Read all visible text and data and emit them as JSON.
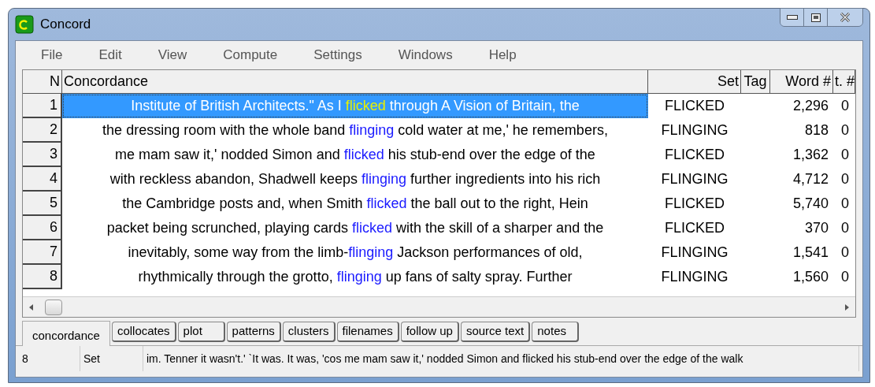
{
  "window": {
    "title": "Concord"
  },
  "menu": [
    "File",
    "Edit",
    "View",
    "Compute",
    "Settings",
    "Windows",
    "Help"
  ],
  "table": {
    "columns": [
      "N",
      "Concordance",
      "Set",
      "Tag",
      "Word #",
      "t. #"
    ],
    "rows": [
      {
        "n": "1",
        "left": "Institute of British Architects.\" As I ",
        "keyword": "flicked",
        "right": " through A Vision of Britain, the",
        "set": "FLICKED",
        "tag": "",
        "word": "2,296",
        "t": "0",
        "selected": true
      },
      {
        "n": "2",
        "left": "the dressing room with the whole band ",
        "keyword": "flinging",
        "right": " cold water at me,' he remembers,",
        "set": "FLINGING",
        "word": "818",
        "t": "0",
        "selected": false
      },
      {
        "n": "3",
        "left": "me mam saw it,' nodded Simon and ",
        "keyword": "flicked",
        "right": " his stub-end over the edge of the",
        "set": "FLICKED",
        "word": "1,362",
        "t": "0",
        "selected": false
      },
      {
        "n": "4",
        "left": "with reckless abandon, Shadwell keeps ",
        "keyword": "flinging",
        "right": " further ingredients into his rich",
        "set": "FLINGING",
        "word": "4,712",
        "t": "0",
        "selected": false
      },
      {
        "n": "5",
        "left": "the Cambridge posts and, when Smith ",
        "keyword": "flicked",
        "right": " the ball out to the right, Hein",
        "set": "FLICKED",
        "word": "5,740",
        "t": "0",
        "selected": false
      },
      {
        "n": "6",
        "left": "packet being scrunched, playing cards ",
        "keyword": "flicked",
        "right": " with the skill of a sharper and the",
        "set": "FLICKED",
        "word": "370",
        "t": "0",
        "selected": false
      },
      {
        "n": "7",
        "left": "inevitably, some way from the limb-",
        "keyword": "flinging",
        "right": " Jackson performances of old,",
        "set": "FLINGING",
        "word": "1,541",
        "t": "0",
        "selected": false
      },
      {
        "n": "8",
        "left": "rhythmically through the grotto, ",
        "keyword": "flinging",
        "right": " up fans of salty spray. Further",
        "set": "FLINGING",
        "word": "1,560",
        "t": "0",
        "selected": false
      }
    ]
  },
  "tabs": [
    {
      "label": "concordance",
      "selected": true
    },
    {
      "label": "collocates",
      "selected": false
    },
    {
      "label": "plot",
      "selected": false
    },
    {
      "label": "patterns",
      "selected": false
    },
    {
      "label": "clusters",
      "selected": false
    },
    {
      "label": "filenames",
      "selected": false
    },
    {
      "label": "follow up",
      "selected": false
    },
    {
      "label": "source text",
      "selected": false
    },
    {
      "label": "notes",
      "selected": false
    }
  ],
  "status_bar": [
    "8",
    "Set",
    "im. Tenner it wasn't.' `It was. It was, 'cos me mam saw it,' nodded Simon and flicked his stub-end over the edge of the walk"
  ]
}
